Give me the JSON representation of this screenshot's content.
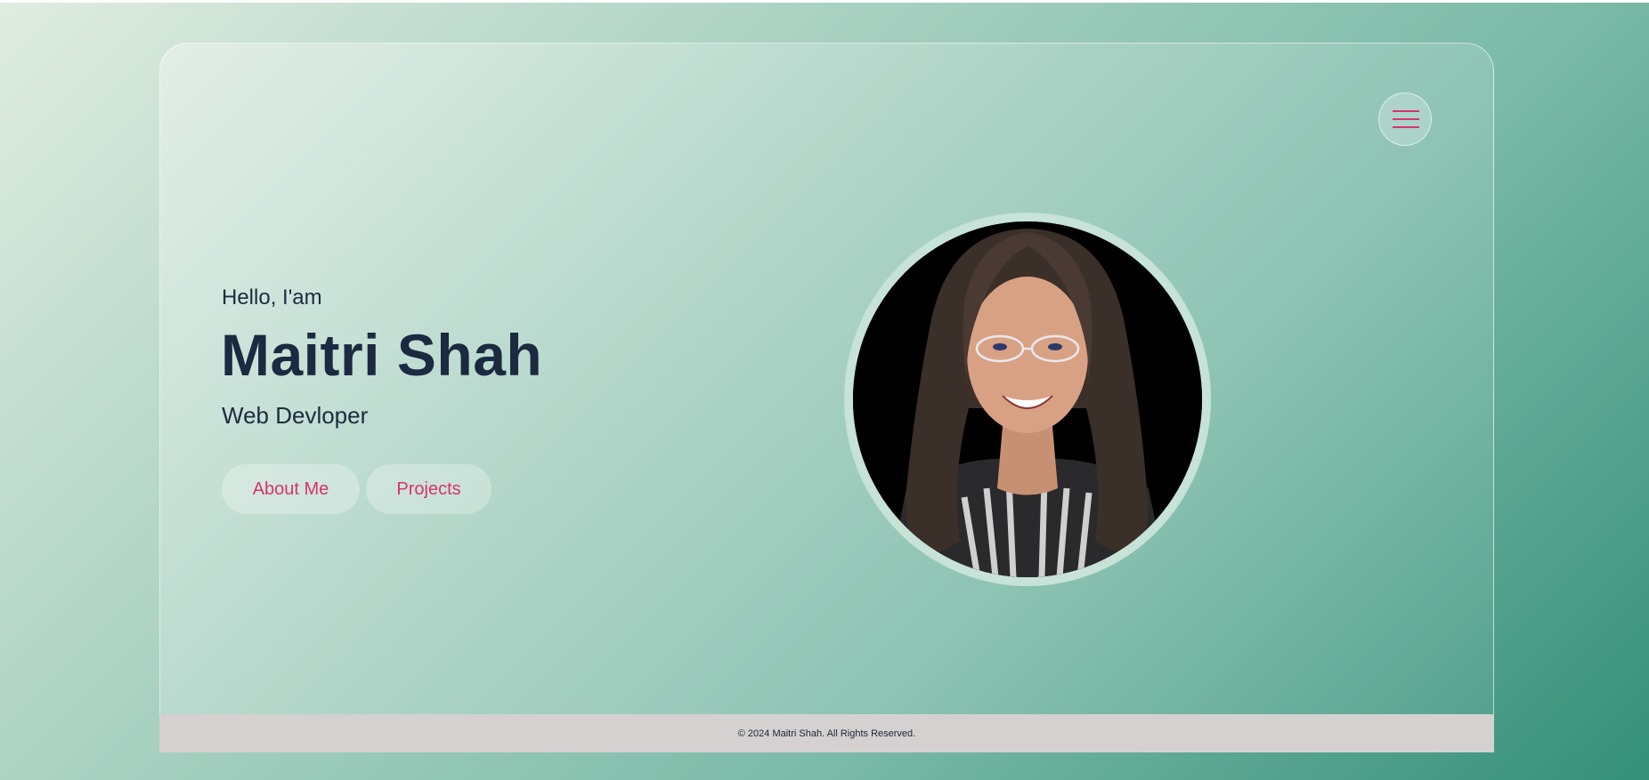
{
  "hero": {
    "greeting": "Hello, I'am",
    "name": "Maitri Shah",
    "role": "Web Devloper",
    "buttons": {
      "about": "About Me",
      "projects": "Projects"
    },
    "profile_image_alt": "Maitri Shah"
  },
  "nav": {
    "menu_icon": "hamburger-menu-icon"
  },
  "footer": {
    "copyright": "© 2024 Maitri Shah. All Rights Reserved."
  },
  "colors": {
    "accent": "#d7336d",
    "heading": "#1b2a40",
    "footer_bg": "#d5d1d1"
  }
}
